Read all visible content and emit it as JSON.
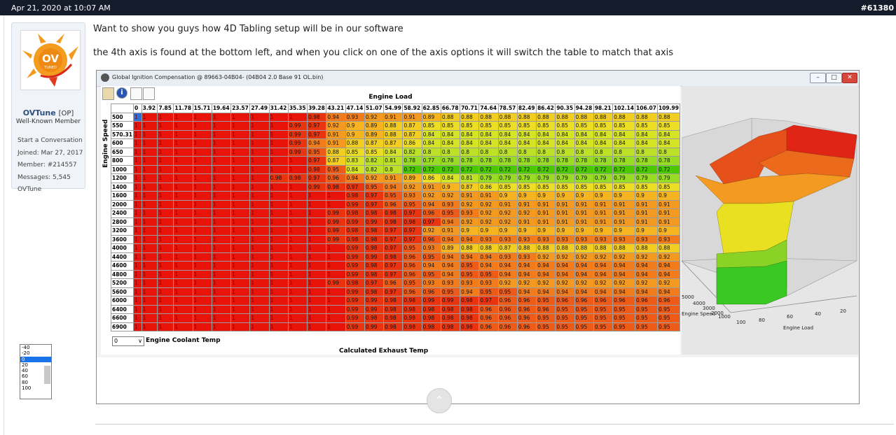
{
  "post": {
    "date": "Apr 21, 2020 at 10:07 AM",
    "number": "#61380",
    "text1": "Want to show you guys how 4D Tabling setup will be in our software",
    "text2": "the 4th axis is found at the bottom left, and when you click on one of the axis options it will switch the table to match that axis"
  },
  "user": {
    "name": "OVTune",
    "op_tag": "[OP]",
    "title": "Well-Known Member",
    "start_conv": "Start a Conversation",
    "joined": "Joined: Mar 27, 2017",
    "member": "Member: #214557",
    "messages": "Messages: 5,545",
    "footer": "OVTune",
    "avatar_text": "OV",
    "avatar_sub": "TUNED"
  },
  "window": {
    "title": "Global Ignition Compensation @ 89663-04B04- (04B04 2.0 Base 91 OL.bin)",
    "info_icon": "i",
    "engine_load_label": "Engine Load",
    "engine_speed_label": "Engine Speed",
    "coolant_label": "Engine Coolant Temp",
    "exhaust_label": "Calculated Exhaust Temp",
    "axis_selected": "0",
    "axis_options": [
      "-40",
      "-20",
      "0",
      "20",
      "40",
      "60",
      "80",
      "100"
    ],
    "plot_labels": {
      "engine_speed": "Engine Speed",
      "engine_load": "Engine Load",
      "ticks_load": [
        "100",
        "80",
        "60",
        "40",
        "20"
      ],
      "ticks_speed": [
        "5000",
        "4000",
        "3000",
        "2000",
        "1000"
      ]
    }
  },
  "table": {
    "cols": [
      "0",
      "3.92",
      "7.85",
      "11.78",
      "15.71",
      "19.64",
      "23.57",
      "27.49",
      "31.42",
      "35.35",
      "39.28",
      "43.21",
      "47.14",
      "51.07",
      "54.99",
      "58.92",
      "62.85",
      "66.78",
      "70.71",
      "74.64",
      "78.57",
      "82.49",
      "86.42",
      "90.35",
      "94.28",
      "98.21",
      "102.14",
      "106.07",
      "109.99"
    ],
    "rows": [
      {
        "rpm": "500",
        "vals": [
          "1",
          "1",
          "1",
          "1",
          "1",
          "1",
          "1",
          "1",
          "1",
          "1",
          "0.98",
          "0.94",
          "0.93",
          "0.92",
          "0.91",
          "0.91",
          "0.89",
          "0.88",
          "0.88",
          "0.88",
          "0.88",
          "0.88",
          "0.88",
          "0.88",
          "0.88",
          "0.88",
          "0.88",
          "0.88",
          "0.88"
        ]
      },
      {
        "rpm": "550",
        "vals": [
          "1",
          "1",
          "1",
          "1",
          "1",
          "1",
          "1",
          "1",
          "1",
          "0.99",
          "0.97",
          "0.92",
          "0.9",
          "0.89",
          "0.88",
          "0.87",
          "0.85",
          "0.85",
          "0.85",
          "0.85",
          "0.85",
          "0.85",
          "0.85",
          "0.85",
          "0.85",
          "0.85",
          "0.85",
          "0.85",
          "0.85"
        ]
      },
      {
        "rpm": "570.31",
        "vals": [
          "1",
          "1",
          "1",
          "1",
          "1",
          "1",
          "1",
          "1",
          "1",
          "0.99",
          "0.97",
          "0.91",
          "0.9",
          "0.89",
          "0.88",
          "0.87",
          "0.84",
          "0.84",
          "0.84",
          "0.84",
          "0.84",
          "0.84",
          "0.84",
          "0.84",
          "0.84",
          "0.84",
          "0.84",
          "0.84",
          "0.84"
        ]
      },
      {
        "rpm": "600",
        "vals": [
          "1",
          "1",
          "1",
          "1",
          "1",
          "1",
          "1",
          "1",
          "1",
          "0.99",
          "0.94",
          "0.91",
          "0.88",
          "0.87",
          "0.87",
          "0.86",
          "0.84",
          "0.84",
          "0.84",
          "0.84",
          "0.84",
          "0.84",
          "0.84",
          "0.84",
          "0.84",
          "0.84",
          "0.84",
          "0.84",
          "0.84"
        ]
      },
      {
        "rpm": "650",
        "vals": [
          "1",
          "1",
          "1",
          "1",
          "1",
          "1",
          "1",
          "1",
          "1",
          "0.99",
          "0.95",
          "0.88",
          "0.85",
          "0.85",
          "0.84",
          "0.82",
          "0.8",
          "0.8",
          "0.8",
          "0.8",
          "0.8",
          "0.8",
          "0.8",
          "0.8",
          "0.8",
          "0.8",
          "0.8",
          "0.8",
          "0.8"
        ]
      },
      {
        "rpm": "800",
        "vals": [
          "1",
          "1",
          "1",
          "1",
          "1",
          "1",
          "1",
          "1",
          "1",
          "1",
          "0.97",
          "0.87",
          "0.83",
          "0.82",
          "0.81",
          "0.78",
          "0.77",
          "0.78",
          "0.78",
          "0.78",
          "0.78",
          "0.78",
          "0.78",
          "0.78",
          "0.78",
          "0.78",
          "0.78",
          "0.78",
          "0.78"
        ]
      },
      {
        "rpm": "1000",
        "vals": [
          "1",
          "1",
          "1",
          "1",
          "1",
          "1",
          "1",
          "1",
          "1",
          "1",
          "0.98",
          "0.95",
          "0.84",
          "0.82",
          "0.8",
          "0.72",
          "0.72",
          "0.72",
          "0.72",
          "0.72",
          "0.72",
          "0.72",
          "0.72",
          "0.72",
          "0.72",
          "0.72",
          "0.72",
          "0.72",
          "0.72"
        ]
      },
      {
        "rpm": "1200",
        "vals": [
          "1",
          "1",
          "1",
          "1",
          "1",
          "1",
          "1",
          "1",
          "0.98",
          "0.98",
          "0.97",
          "0.96",
          "0.94",
          "0.92",
          "0.91",
          "0.89",
          "0.86",
          "0.84",
          "0.81",
          "0.79",
          "0.79",
          "0.79",
          "0.79",
          "0.79",
          "0.79",
          "0.79",
          "0.79",
          "0.79",
          "0.79"
        ]
      },
      {
        "rpm": "1400",
        "vals": [
          "1",
          "1",
          "1",
          "1",
          "1",
          "1",
          "1",
          "1",
          "1",
          "1",
          "0.99",
          "0.98",
          "0.97",
          "0.95",
          "0.94",
          "0.92",
          "0.91",
          "0.9",
          "0.87",
          "0.86",
          "0.85",
          "0.85",
          "0.85",
          "0.85",
          "0.85",
          "0.85",
          "0.85",
          "0.85",
          "0.85"
        ]
      },
      {
        "rpm": "1600",
        "vals": [
          "1",
          "1",
          "1",
          "1",
          "1",
          "1",
          "1",
          "1",
          "1",
          "1",
          "1",
          "1",
          "0.98",
          "0.97",
          "0.95",
          "0.93",
          "0.92",
          "0.92",
          "0.91",
          "0.91",
          "0.9",
          "0.9",
          "0.9",
          "0.9",
          "0.9",
          "0.9",
          "0.9",
          "0.9",
          "0.9"
        ]
      },
      {
        "rpm": "2000",
        "vals": [
          "1",
          "1",
          "1",
          "1",
          "1",
          "1",
          "1",
          "1",
          "1",
          "1",
          "1",
          "1",
          "0.99",
          "0.97",
          "0.96",
          "0.95",
          "0.94",
          "0.93",
          "0.92",
          "0.92",
          "0.91",
          "0.91",
          "0.91",
          "0.91",
          "0.91",
          "0.91",
          "0.91",
          "0.91",
          "0.91"
        ]
      },
      {
        "rpm": "2400",
        "vals": [
          "1",
          "1",
          "1",
          "1",
          "1",
          "1",
          "1",
          "1",
          "1",
          "1",
          "1",
          "0.99",
          "0.98",
          "0.98",
          "0.98",
          "0.97",
          "0.96",
          "0.95",
          "0.93",
          "0.92",
          "0.92",
          "0.92",
          "0.91",
          "0.91",
          "0.91",
          "0.91",
          "0.91",
          "0.91",
          "0.91"
        ]
      },
      {
        "rpm": "2800",
        "vals": [
          "1",
          "1",
          "1",
          "1",
          "1",
          "1",
          "1",
          "1",
          "1",
          "1",
          "1",
          "0.99",
          "0.99",
          "0.99",
          "0.98",
          "0.98",
          "0.97",
          "0.94",
          "0.92",
          "0.92",
          "0.92",
          "0.91",
          "0.91",
          "0.91",
          "0.91",
          "0.91",
          "0.91",
          "0.91",
          "0.91"
        ]
      },
      {
        "rpm": "3200",
        "vals": [
          "1",
          "1",
          "1",
          "1",
          "1",
          "1",
          "1",
          "1",
          "1",
          "1",
          "1",
          "0.99",
          "0.98",
          "0.98",
          "0.97",
          "0.97",
          "0.92",
          "0.91",
          "0.9",
          "0.9",
          "0.9",
          "0.9",
          "0.9",
          "0.9",
          "0.9",
          "0.9",
          "0.9",
          "0.9",
          "0.9"
        ]
      },
      {
        "rpm": "3600",
        "vals": [
          "1",
          "1",
          "1",
          "1",
          "1",
          "1",
          "1",
          "1",
          "1",
          "1",
          "1",
          "0.99",
          "0.98",
          "0.98",
          "0.97",
          "0.97",
          "0.96",
          "0.94",
          "0.94",
          "0.93",
          "0.93",
          "0.93",
          "0.93",
          "0.93",
          "0.93",
          "0.93",
          "0.93",
          "0.93",
          "0.93"
        ]
      },
      {
        "rpm": "4000",
        "vals": [
          "1",
          "1",
          "1",
          "1",
          "1",
          "1",
          "1",
          "1",
          "1",
          "1",
          "1",
          "1",
          "0.99",
          "0.98",
          "0.97",
          "0.95",
          "0.93",
          "0.89",
          "0.88",
          "0.88",
          "0.87",
          "0.88",
          "0.88",
          "0.88",
          "0.88",
          "0.88",
          "0.88",
          "0.88",
          "0.88"
        ]
      },
      {
        "rpm": "4400",
        "vals": [
          "1",
          "1",
          "1",
          "1",
          "1",
          "1",
          "1",
          "1",
          "1",
          "1",
          "1",
          "1",
          "0.99",
          "0.99",
          "0.98",
          "0.96",
          "0.95",
          "0.94",
          "0.94",
          "0.94",
          "0.93",
          "0.93",
          "0.92",
          "0.92",
          "0.92",
          "0.92",
          "0.92",
          "0.92",
          "0.92"
        ]
      },
      {
        "rpm": "4600",
        "vals": [
          "1",
          "1",
          "1",
          "1",
          "1",
          "1",
          "1",
          "1",
          "1",
          "1",
          "1",
          "1",
          "0.99",
          "0.98",
          "0.97",
          "0.96",
          "0.94",
          "0.94",
          "0.95",
          "0.94",
          "0.94",
          "0.94",
          "0.94",
          "0.94",
          "0.94",
          "0.94",
          "0.94",
          "0.94",
          "0.94"
        ]
      },
      {
        "rpm": "4800",
        "vals": [
          "1",
          "1",
          "1",
          "1",
          "1",
          "1",
          "1",
          "1",
          "1",
          "1",
          "1",
          "1",
          "0.99",
          "0.98",
          "0.97",
          "0.96",
          "0.95",
          "0.94",
          "0.95",
          "0.95",
          "0.94",
          "0.94",
          "0.94",
          "0.94",
          "0.94",
          "0.94",
          "0.94",
          "0.94",
          "0.94"
        ]
      },
      {
        "rpm": "5200",
        "vals": [
          "1",
          "1",
          "1",
          "1",
          "1",
          "1",
          "1",
          "1",
          "1",
          "1",
          "1",
          "0.99",
          "0.98",
          "0.97",
          "0.96",
          "0.95",
          "0.93",
          "0.93",
          "0.93",
          "0.93",
          "0.92",
          "0.92",
          "0.92",
          "0.92",
          "0.92",
          "0.92",
          "0.92",
          "0.92",
          "0.92"
        ]
      },
      {
        "rpm": "5600",
        "vals": [
          "1",
          "1",
          "1",
          "1",
          "1",
          "1",
          "1",
          "1",
          "1",
          "1",
          "1",
          "1",
          "0.99",
          "0.98",
          "0.97",
          "0.96",
          "0.96",
          "0.95",
          "0.94",
          "0.95",
          "0.95",
          "0.94",
          "0.94",
          "0.94",
          "0.94",
          "0.94",
          "0.94",
          "0.94",
          "0.94"
        ]
      },
      {
        "rpm": "6000",
        "vals": [
          "1",
          "1",
          "1",
          "1",
          "1",
          "1",
          "1",
          "1",
          "1",
          "1",
          "1",
          "1",
          "0.99",
          "0.99",
          "0.98",
          "0.98",
          "0.99",
          "0.99",
          "0.98",
          "0.97",
          "0.96",
          "0.96",
          "0.95",
          "0.96",
          "0.96",
          "0.96",
          "0.96",
          "0.96",
          "0.96"
        ]
      },
      {
        "rpm": "6400",
        "vals": [
          "1",
          "1",
          "1",
          "1",
          "1",
          "1",
          "1",
          "1",
          "1",
          "1",
          "1",
          "1",
          "0.99",
          "0.99",
          "0.98",
          "0.98",
          "0.98",
          "0.98",
          "0.98",
          "0.96",
          "0.96",
          "0.96",
          "0.96",
          "0.95",
          "0.95",
          "0.95",
          "0.95",
          "0.95",
          "0.95"
        ]
      },
      {
        "rpm": "6600",
        "vals": [
          "1",
          "1",
          "1",
          "1",
          "1",
          "1",
          "1",
          "1",
          "1",
          "1",
          "1",
          "1",
          "0.99",
          "0.98",
          "0.98",
          "0.98",
          "0.98",
          "0.98",
          "0.98",
          "0.96",
          "0.96",
          "0.96",
          "0.95",
          "0.95",
          "0.95",
          "0.95",
          "0.95",
          "0.95",
          "0.95"
        ]
      },
      {
        "rpm": "6900",
        "vals": [
          "1",
          "1",
          "1",
          "1",
          "1",
          "1",
          "1",
          "1",
          "1",
          "1",
          "1",
          "1",
          "0.99",
          "0.99",
          "0.98",
          "0.98",
          "0.98",
          "0.98",
          "0.98",
          "0.96",
          "0.96",
          "0.96",
          "0.95",
          "0.95",
          "0.95",
          "0.95",
          "0.95",
          "0.95",
          "0.95"
        ]
      }
    ]
  },
  "colors": {
    "accent": "#2c4f7c",
    "header_bg": "#141b2b",
    "red": "#e8140a",
    "green": "#4ac800"
  }
}
